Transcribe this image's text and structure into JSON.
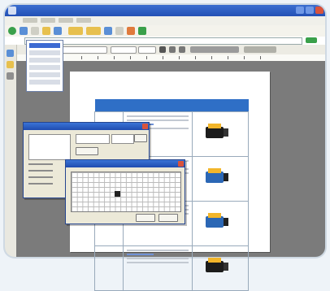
{
  "app": {
    "icons": {
      "menu_icon": "menu-icon",
      "camera_icon": "camera-icon",
      "close_icon": "close-icon"
    },
    "accent": "#2f6fc6",
    "title_color": "#2350b5"
  }
}
